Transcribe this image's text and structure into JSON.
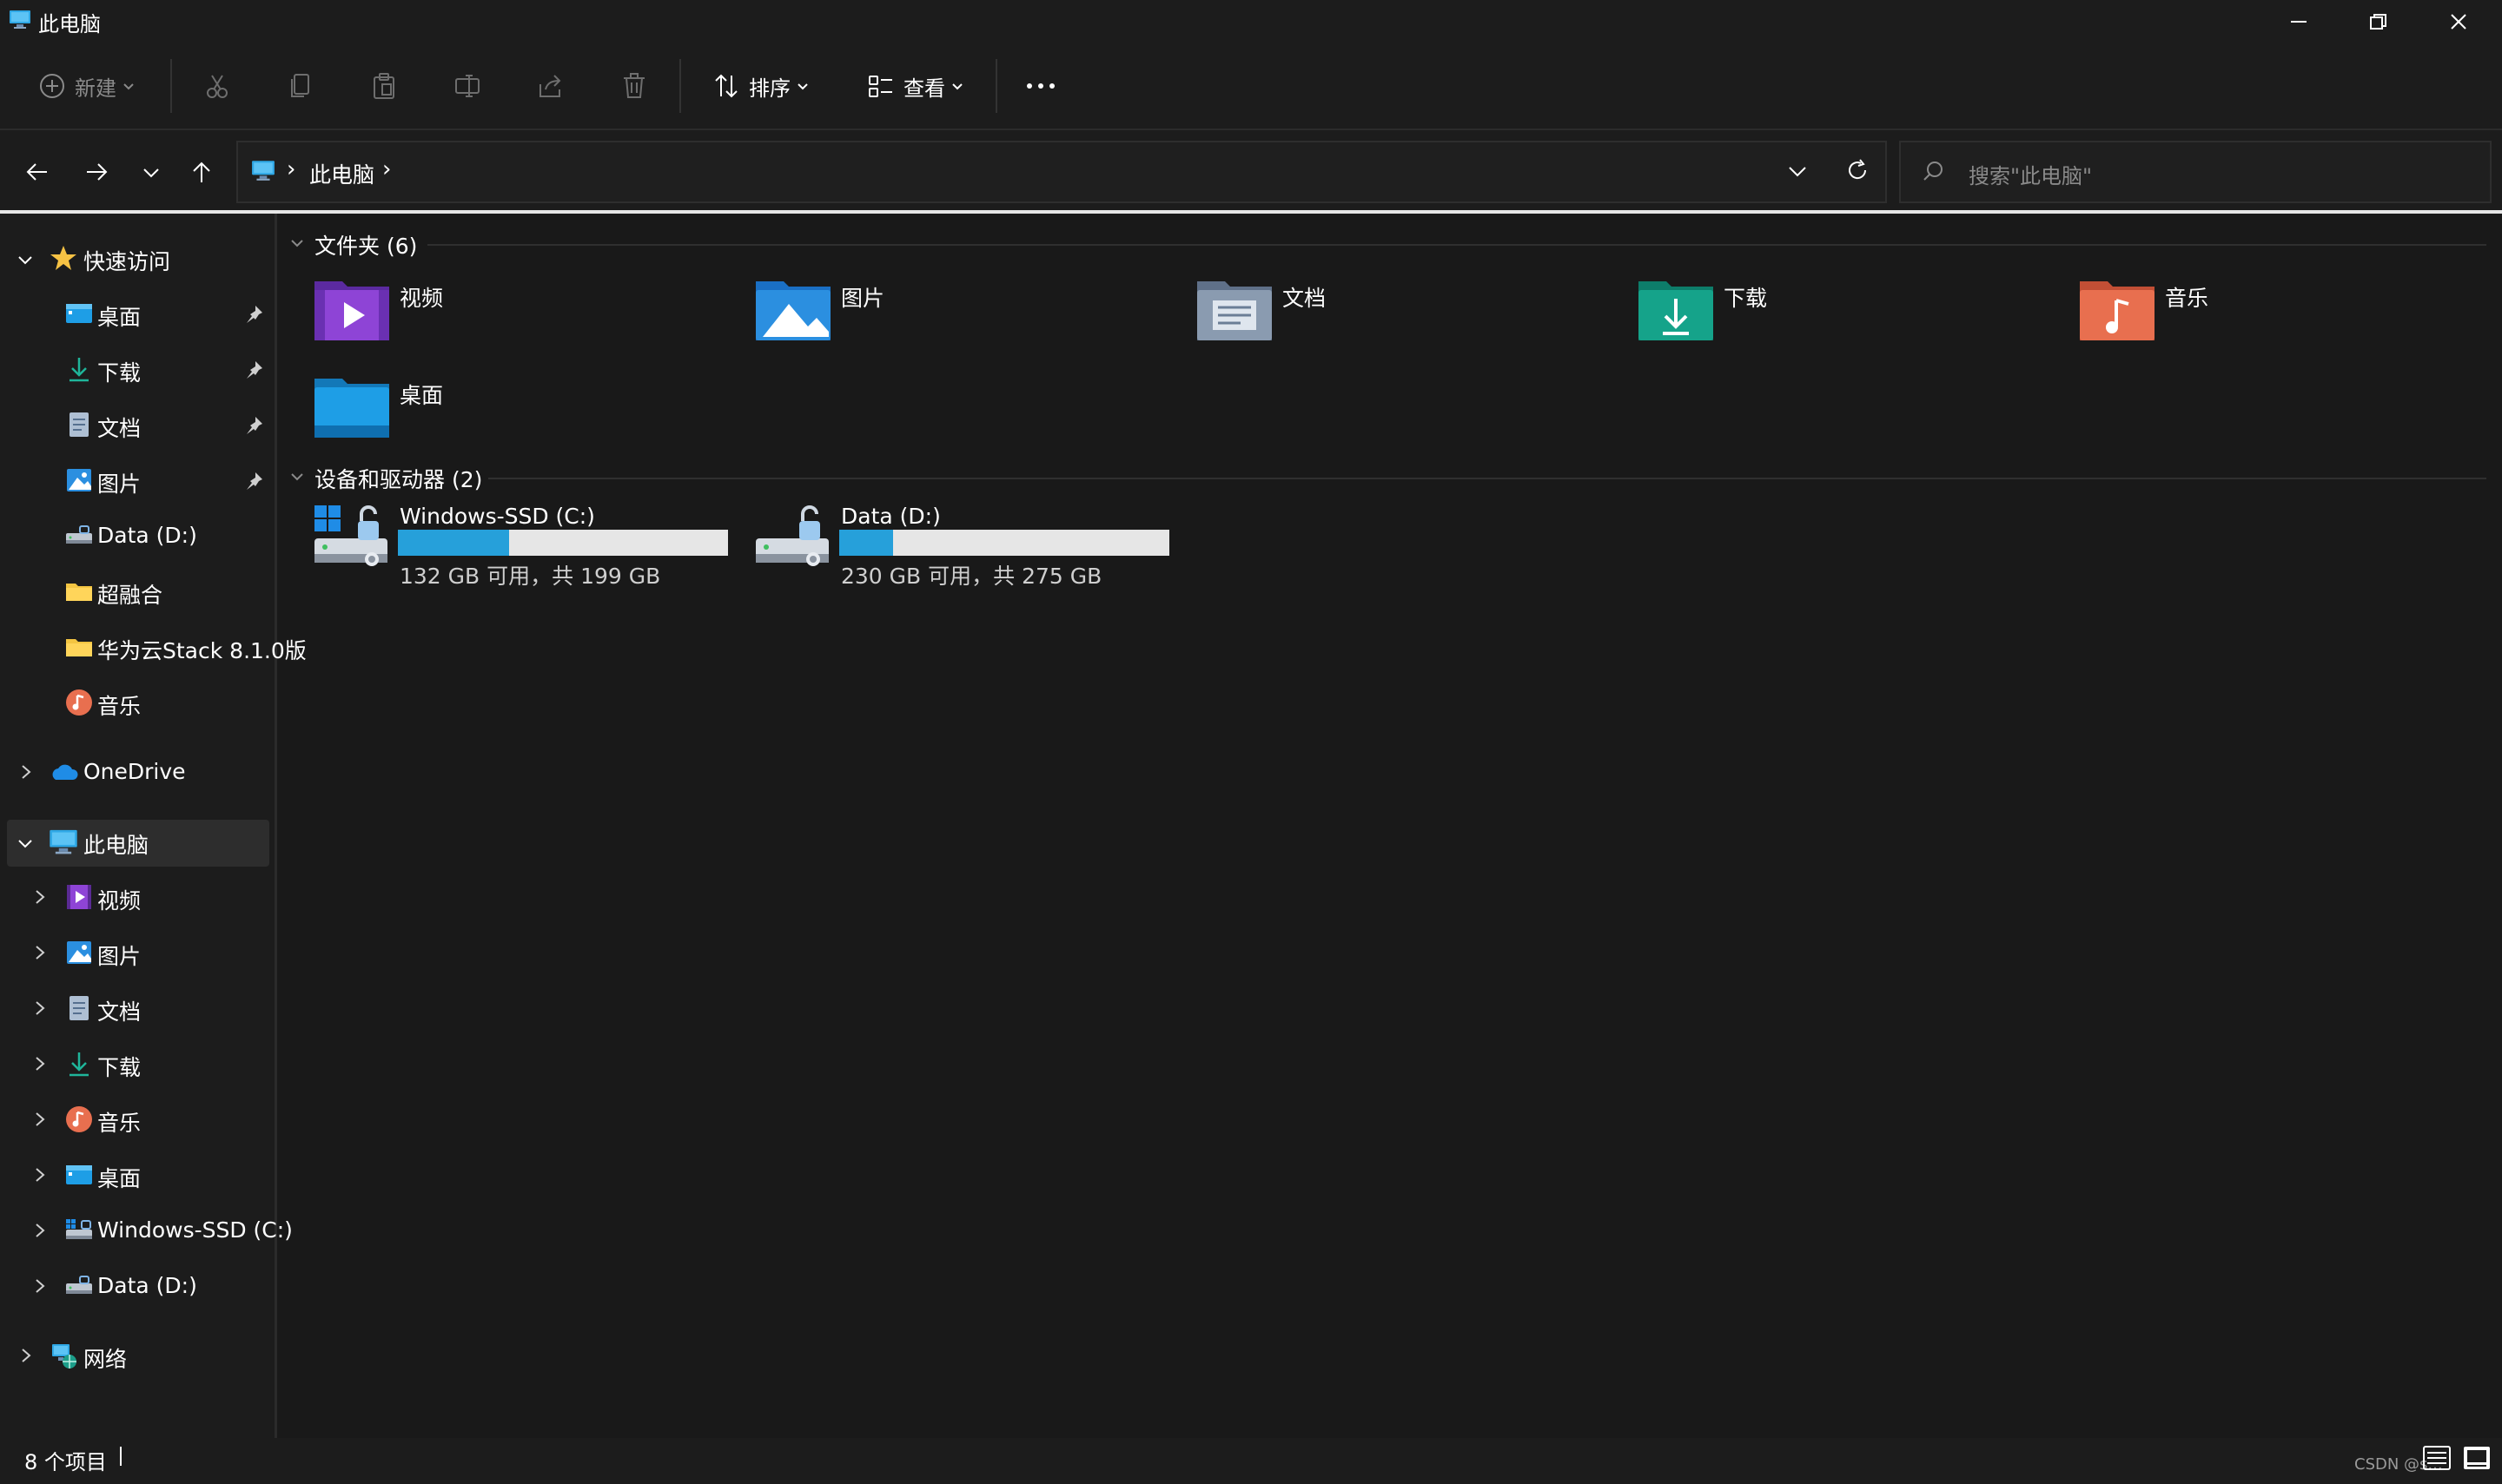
{
  "window": {
    "title": "此电脑",
    "icon": "monitor-icon",
    "controls": [
      "minimize-icon",
      "restore-icon",
      "close-icon"
    ]
  },
  "toolbar": {
    "new_label": "新建",
    "sort_label": "排序",
    "view_label": "查看",
    "actions": [
      "cut-icon",
      "copy-icon",
      "paste-icon",
      "rename-icon",
      "share-icon",
      "delete-icon",
      "more-icon"
    ]
  },
  "address": {
    "crumb": "此电脑",
    "separator": "›",
    "search_placeholder": "搜索\"此电脑\""
  },
  "sidebar": {
    "quick_access": {
      "label": "快速访问",
      "items": [
        {
          "label": "桌面",
          "icon": "desktop-icon",
          "pinned": true
        },
        {
          "label": "下载",
          "icon": "download-icon",
          "pinned": true
        },
        {
          "label": "文档",
          "icon": "document-icon",
          "pinned": true
        },
        {
          "label": "图片",
          "icon": "picture-icon",
          "pinned": true
        },
        {
          "label": "Data (D:)",
          "icon": "drive-icon",
          "pinned": false
        },
        {
          "label": "超融合",
          "icon": "folder-icon",
          "pinned": false
        },
        {
          "label": "华为云Stack 8.1.0版",
          "icon": "folder-icon",
          "pinned": false
        },
        {
          "label": "音乐",
          "icon": "music-icon",
          "pinned": false
        }
      ]
    },
    "onedrive": {
      "label": "OneDrive"
    },
    "this_pc": {
      "label": "此电脑",
      "items": [
        {
          "label": "视频",
          "icon": "video-icon"
        },
        {
          "label": "图片",
          "icon": "picture-icon"
        },
        {
          "label": "文档",
          "icon": "document-icon"
        },
        {
          "label": "下载",
          "icon": "download-icon"
        },
        {
          "label": "音乐",
          "icon": "music-icon"
        },
        {
          "label": "桌面",
          "icon": "desktop-icon"
        },
        {
          "label": "Windows-SSD (C:)",
          "icon": "drive-icon"
        },
        {
          "label": "Data (D:)",
          "icon": "drive-icon"
        }
      ]
    },
    "network": {
      "label": "网络"
    }
  },
  "content": {
    "folders_header": "文件夹 (6)",
    "folders": [
      {
        "label": "视频",
        "icon": "video-folder-icon",
        "color": "#8e44d6"
      },
      {
        "label": "图片",
        "icon": "pictures-folder-icon",
        "color": "#2b8fe0"
      },
      {
        "label": "文档",
        "icon": "documents-folder-icon",
        "color": "#8a9bb0"
      },
      {
        "label": "下载",
        "icon": "downloads-folder-icon",
        "color": "#15a38a"
      },
      {
        "label": "音乐",
        "icon": "music-folder-icon",
        "color": "#e86f4f"
      },
      {
        "label": "桌面",
        "icon": "desktop-folder-icon",
        "color": "#1e9ee6"
      }
    ],
    "drives_header": "设备和驱动器 (2)",
    "drives": [
      {
        "label": "Windows-SSD (C:)",
        "free_text": "132 GB 可用，共 199 GB",
        "used_fraction": 0.337,
        "bar_color": "#26a0da"
      },
      {
        "label": "Data (D:)",
        "free_text": "230 GB 可用，共 275 GB",
        "used_fraction": 0.164,
        "bar_color": "#26a0da"
      }
    ]
  },
  "status": {
    "count": "8 个项目",
    "watermark": "CSDN @s..."
  },
  "colors": {
    "background": "#191919",
    "chrome": "#1c1c1c",
    "selection": "#2d2d2d",
    "accent": "#26a0da"
  }
}
